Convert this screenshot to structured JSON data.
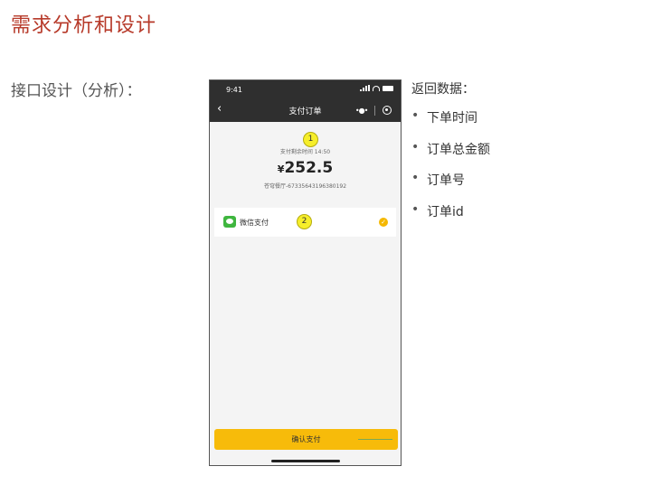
{
  "slide": {
    "title": "需求分析和设计",
    "left_label": "接口设计（分析）："
  },
  "phone": {
    "status_time": "9:41",
    "nav_title": "支付订单",
    "markers": [
      "1",
      "2"
    ],
    "remaining_time_text": "支付剩余时间 14:50",
    "currency_symbol": "¥",
    "amount": "252.5",
    "order_text": "苍穹餐厅-67335643196380192",
    "pay_method_label": "微信支付",
    "confirm_button_label": "确认支付"
  },
  "return_data": {
    "label": "返回数据：",
    "bullet": "•",
    "items": [
      "下单时间",
      "订单总金额",
      "订单号",
      "订单id"
    ]
  }
}
